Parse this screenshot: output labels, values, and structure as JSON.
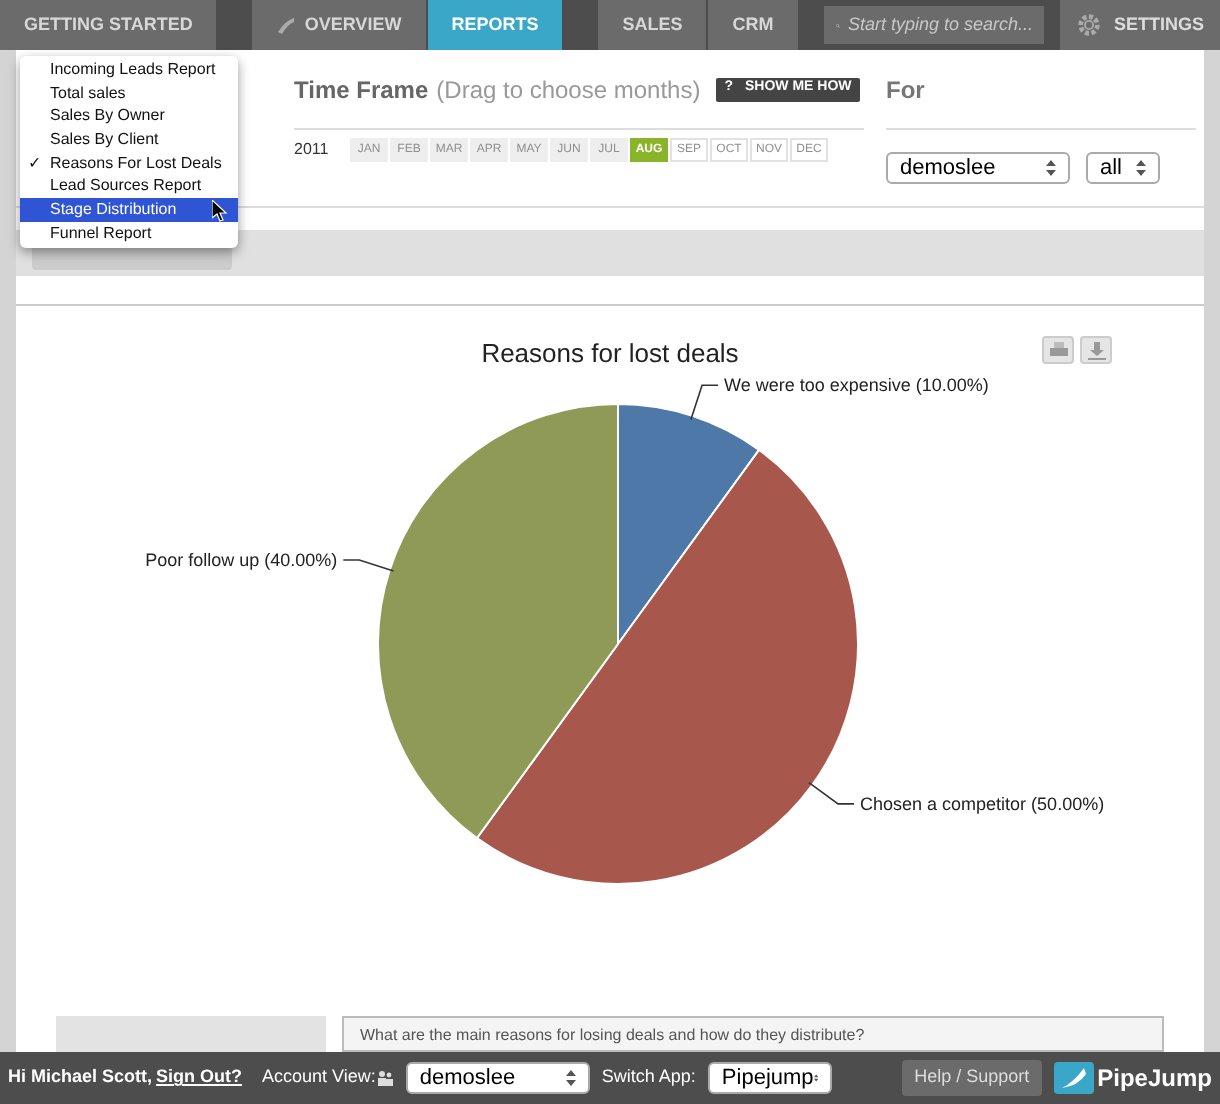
{
  "nav": {
    "tabs": [
      {
        "label": "GETTING STARTED",
        "selected": false,
        "kind": "plain"
      },
      {
        "label": "OVERVIEW",
        "selected": false,
        "kind": "phone"
      },
      {
        "label": "REPORTS",
        "selected": true,
        "kind": "plain"
      },
      {
        "label": "SALES",
        "selected": false,
        "kind": "plain"
      },
      {
        "label": "CRM",
        "selected": false,
        "kind": "plain"
      }
    ],
    "search": {
      "placeholder": "Start typing to search..."
    },
    "settings": "SETTINGS"
  },
  "report_menu": [
    {
      "label": "Incoming Leads Report",
      "checked": false,
      "highlighted": false
    },
    {
      "label": "Total sales",
      "checked": false,
      "highlighted": false
    },
    {
      "label": "Sales By Owner",
      "checked": false,
      "highlighted": false
    },
    {
      "label": "Sales By Client",
      "checked": false,
      "highlighted": false
    },
    {
      "label": "Reasons For Lost Deals",
      "checked": true,
      "highlighted": false
    },
    {
      "label": "Lead Sources Report",
      "checked": false,
      "highlighted": false
    },
    {
      "label": "Stage Distribution",
      "checked": false,
      "highlighted": true
    },
    {
      "label": "Funnel Report",
      "checked": false,
      "highlighted": false
    }
  ],
  "check_mark": "✓",
  "time_frame": {
    "title": "Time Frame",
    "hint": "(Drag to choose months)",
    "help": "?",
    "show_me_how": "SHOW ME HOW",
    "year": "2011",
    "months": [
      {
        "label": "JAN",
        "kind": "past",
        "selected": false
      },
      {
        "label": "FEB",
        "kind": "past",
        "selected": false
      },
      {
        "label": "MAR",
        "kind": "past",
        "selected": false
      },
      {
        "label": "APR",
        "kind": "past",
        "selected": false
      },
      {
        "label": "MAY",
        "kind": "past",
        "selected": false
      },
      {
        "label": "JUN",
        "kind": "past",
        "selected": false
      },
      {
        "label": "JUL",
        "kind": "past",
        "selected": false
      },
      {
        "label": "AUG",
        "kind": "past",
        "selected": true
      },
      {
        "label": "SEP",
        "kind": "future",
        "selected": false
      },
      {
        "label": "OCT",
        "kind": "future",
        "selected": false
      },
      {
        "label": "NOV",
        "kind": "future",
        "selected": false
      },
      {
        "label": "DEC",
        "kind": "future",
        "selected": false
      }
    ]
  },
  "for": {
    "title": "For",
    "user": "demoslee",
    "scope": "all"
  },
  "chart": {
    "chart_data": {
      "type": "pie",
      "title": "Reasons for lost deals",
      "categories": [
        "We were too expensive",
        "Chosen a competitor",
        "Poor follow up"
      ],
      "values": [
        10,
        50,
        40
      ],
      "colors": [
        "#4e78a8",
        "#a8574c",
        "#8e9a55"
      ],
      "value_labels": [
        "(10.00%)",
        "(50.00%)",
        "(40.00%)"
      ],
      "data_labels": true
    }
  },
  "question": "What are the main reasons for losing deals and how do they distribute?",
  "footer": {
    "greeting": "Hi Michael Scott,",
    "sign_out": "Sign Out?",
    "account_view_label": "Account View:",
    "account_view": "demoslee",
    "switch_app_label": "Switch App:",
    "switch_app": "Pipejump",
    "help": "Help / Support",
    "brand": "PipeJump"
  }
}
